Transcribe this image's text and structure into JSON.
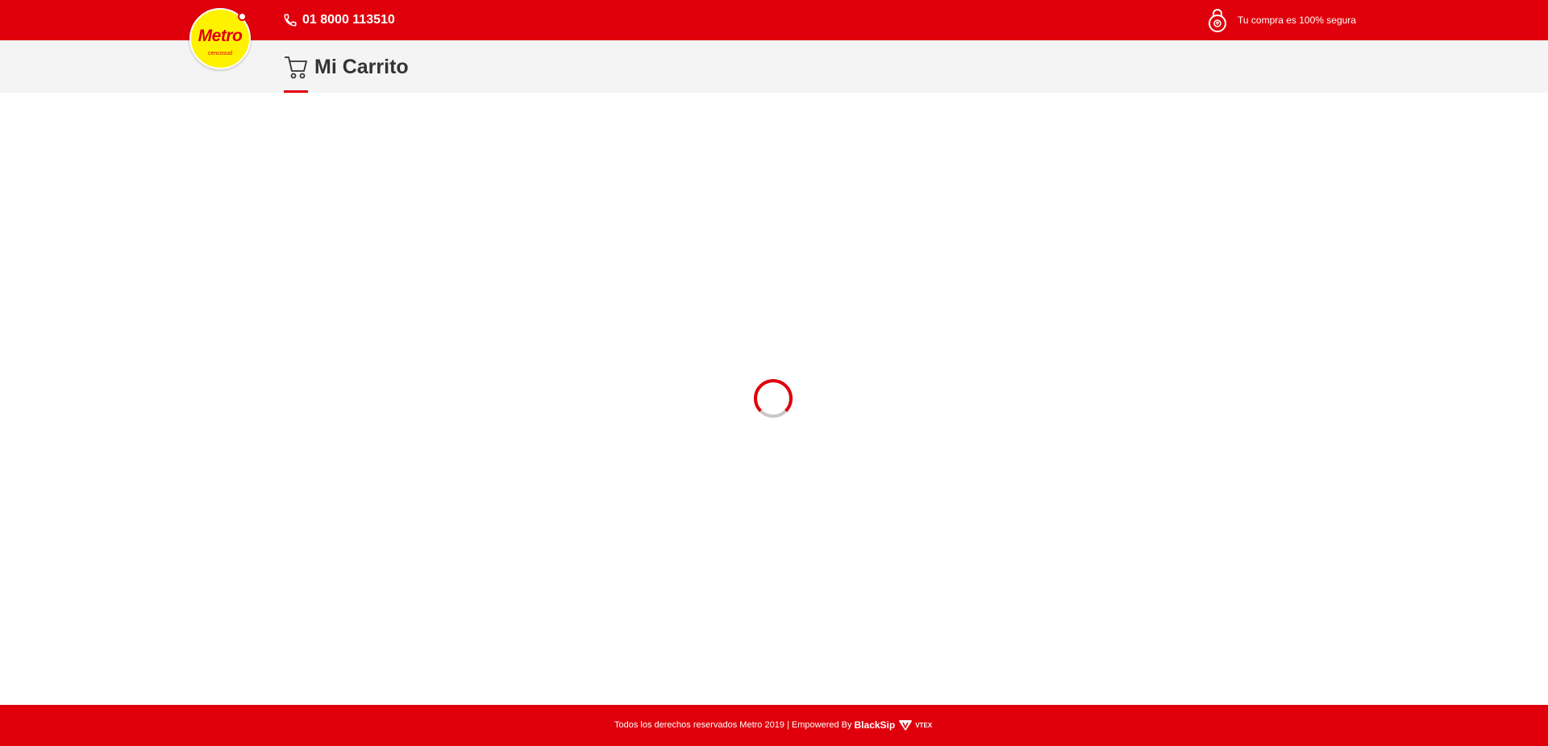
{
  "header": {
    "logo_text": "Metro",
    "logo_subtext": "cencosud",
    "phone": "01 8000 113510",
    "secure_text": "Tu compra es 100% segura"
  },
  "subheader": {
    "title": "Mi Carrito"
  },
  "main": {
    "loading": true
  },
  "footer": {
    "text": "Todos los derechos reservados Metro 2019 | Empowered By",
    "brand": "BlackSip",
    "partner": "VTEX"
  },
  "colors": {
    "brand_red": "#e0000b",
    "logo_yellow": "#fff200",
    "subbar_bg": "#f4f4f4",
    "title_text": "#333333",
    "spinner_track": "#c8c8c8"
  },
  "icons": [
    "phone-icon",
    "lock-icon",
    "cart-icon",
    "loading-spinner",
    "vtex-icon"
  ]
}
